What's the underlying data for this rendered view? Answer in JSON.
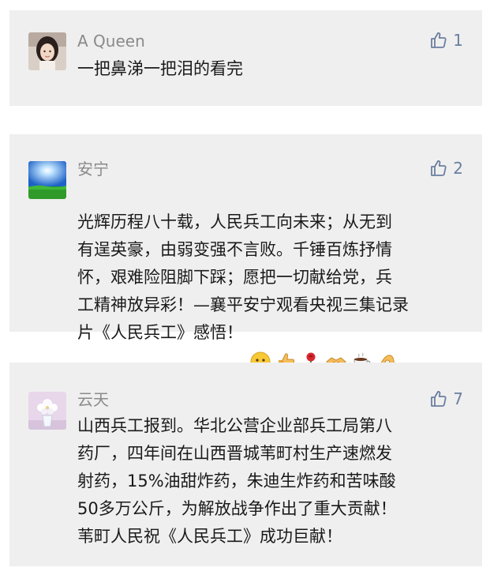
{
  "comments": [
    {
      "user": "A Queen",
      "avatar": "woman-portrait-avatar",
      "likes": "1",
      "text": "一把鼻涕一把泪的看完"
    },
    {
      "user": "安宁",
      "avatar": "blue-sky-grass-avatar",
      "likes": "2",
      "text": "光辉历程八十载，人民兵工向未来；从无到\n有逞英豪，由弱变强不言败。千锤百炼抒情\n怀，艰难险阻脚下踩；愿把一切献给党，兵\n工精神放异彩！—襄平安宁观看央视三集记录\n片《人民兵工》感悟！",
      "emojis": [
        "smile-emoji",
        "thumbs-up-emoji",
        "rose-emoji",
        "handshake-emoji",
        "coffee-emoji",
        "ok-hand-emoji"
      ]
    },
    {
      "user": "云天",
      "avatar": "flower-vase-avatar",
      "likes": "7",
      "text": "山西兵工报到。华北公营企业部兵工局第八\n药厂，四年间在山西晋城苇町村生产速燃发\n射药，15%油甜炸药，朱迪生炸药和苦味酸\n50多万公斤，为解放战争作出了重大贡献！\n苇町人民祝《人民兵工》成功巨献！"
    }
  ],
  "colors": {
    "card_bg": "#efefef",
    "name": "#8a8a8a",
    "like": "#6b7fa0",
    "text": "#1a1a1a"
  }
}
